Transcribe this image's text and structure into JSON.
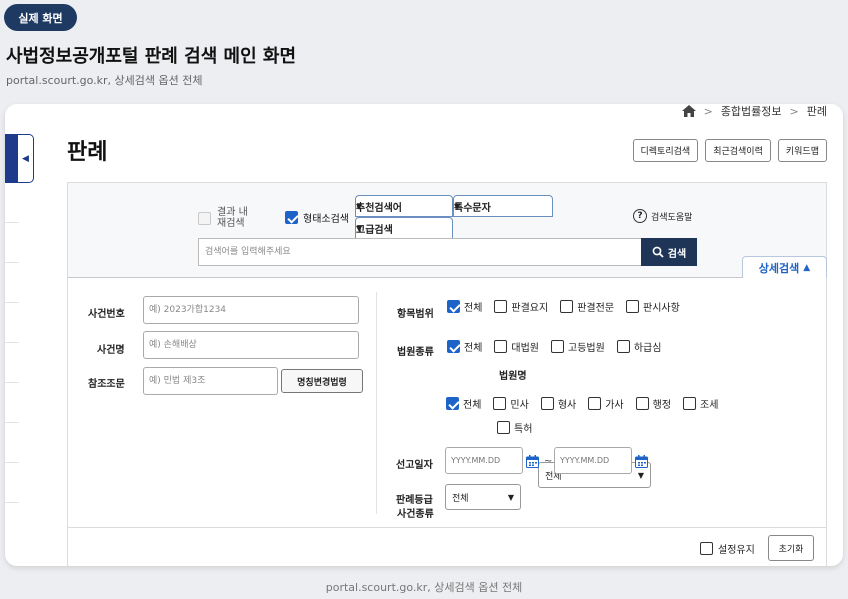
{
  "badge": "실제 화면",
  "heading": "사법정보공개포털 판례 검색 메인 화면",
  "subheading": "portal.scourt.go.kr, 상세검색 옵션 전체",
  "footer_caption": "portal.scourt.go.kr, 상세검색 옵션 전체",
  "breadcrumb": {
    "items": [
      "종합법률정보",
      "판례"
    ],
    "separator": ">"
  },
  "title": "판례",
  "top_buttons": [
    "디렉토리검색",
    "최근검색이력",
    "키워드맵"
  ],
  "search": {
    "result_within": "결과 내 재검색",
    "morph": "형태소검색",
    "tabs": {
      "recommend": "추천검색어",
      "special_chars": "특수문자",
      "advanced": "고급검색"
    },
    "help": "검색도움말",
    "placeholder": "검색어를 입력해주세요",
    "button": "검색"
  },
  "detail_toggle": "상세검색",
  "detail": {
    "case_number": {
      "label": "사건번호",
      "placeholder": "예) 2023가합1234"
    },
    "case_name": {
      "label": "사건명",
      "placeholder": "예) 손해배상"
    },
    "ref_law": {
      "label": "참조조문",
      "placeholder": "예) 민법 제3조",
      "button": "명칭변경법령"
    },
    "scope": {
      "label": "항목범위",
      "options": [
        "전체",
        "판결요지",
        "판결전문",
        "판시사항"
      ]
    },
    "court_type": {
      "label": "법원종류",
      "options": [
        "전체",
        "대법원",
        "고등법원",
        "하급심"
      ]
    },
    "court_name": {
      "label": "법원명",
      "value": "전체"
    },
    "case_type": {
      "label": "사건종류",
      "options": [
        "전체",
        "민사",
        "형사",
        "가사",
        "행정",
        "조세"
      ],
      "options2": [
        "특허"
      ]
    },
    "date": {
      "label": "선고일자",
      "placeholder": "YYYY.MM.DD",
      "tilde": "~"
    },
    "grade": {
      "label": "판례등급",
      "value": "전체"
    }
  },
  "bottom": {
    "keep": "설정유지",
    "reset": "초기화"
  },
  "colors": {
    "navy": "#1e3557",
    "accent": "#1e63c7",
    "badge": "#1e3a63"
  }
}
